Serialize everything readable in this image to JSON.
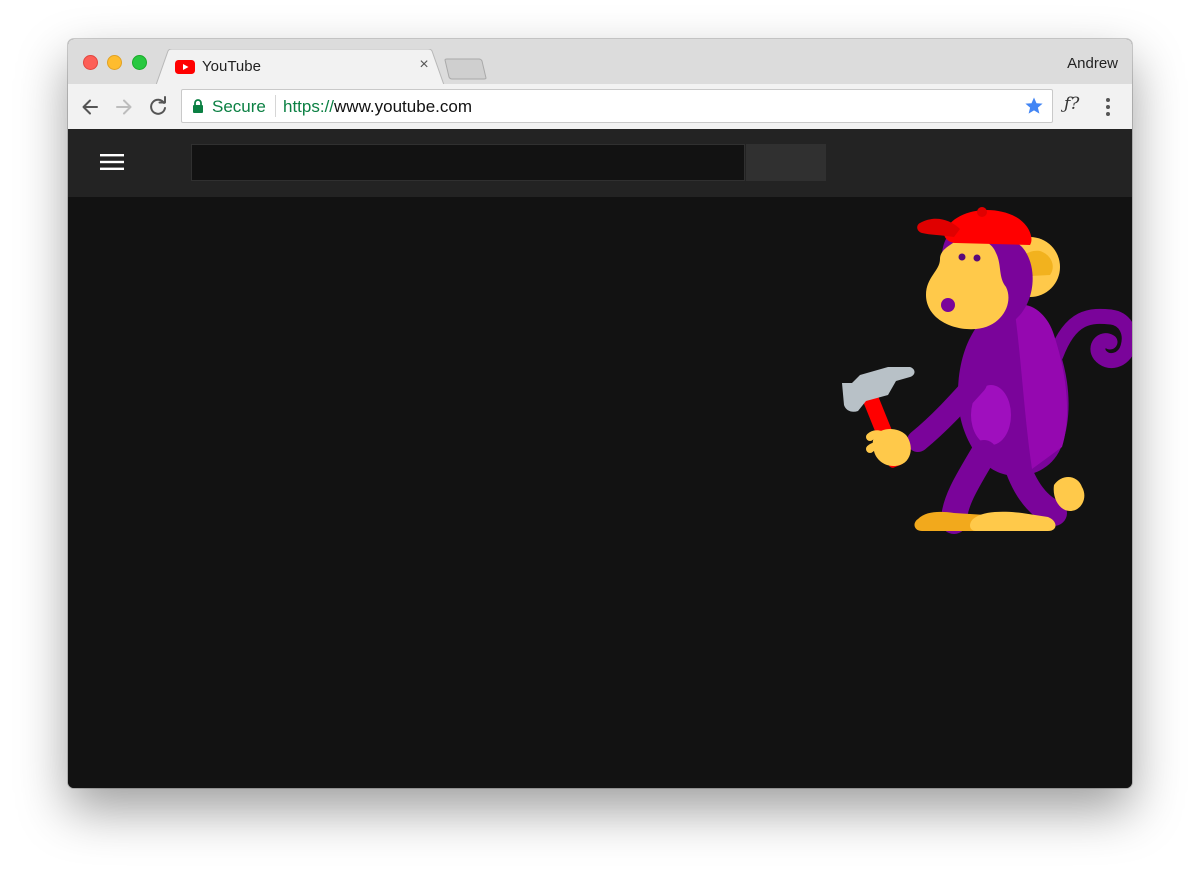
{
  "browser": {
    "tab": {
      "title": "YouTube",
      "close_glyph": "×"
    },
    "profile_name": "Andrew",
    "omnibox": {
      "security_label": "Secure",
      "url_scheme": "https://",
      "url_host": "www.youtube.com"
    },
    "extension_label": "ƒ?"
  },
  "icons": {
    "traffic_lights": [
      "close-light",
      "minimize-light",
      "maximize-light"
    ],
    "favicon": "youtube-favicon-icon",
    "back": "back-arrow-icon",
    "forward": "forward-arrow-icon",
    "reload": "reload-icon",
    "lock": "lock-icon",
    "bookmark": "star-icon",
    "menu": "kebab-menu-icon",
    "hamburger": "hamburger-menu-icon",
    "illustration": "monkey-with-hammer-illustration"
  },
  "colors": {
    "page_background": "#121212",
    "header_background": "#232323",
    "secure_green": "#0b8043",
    "star_blue": "#4285f4",
    "youtube_red": "#ff0000"
  }
}
